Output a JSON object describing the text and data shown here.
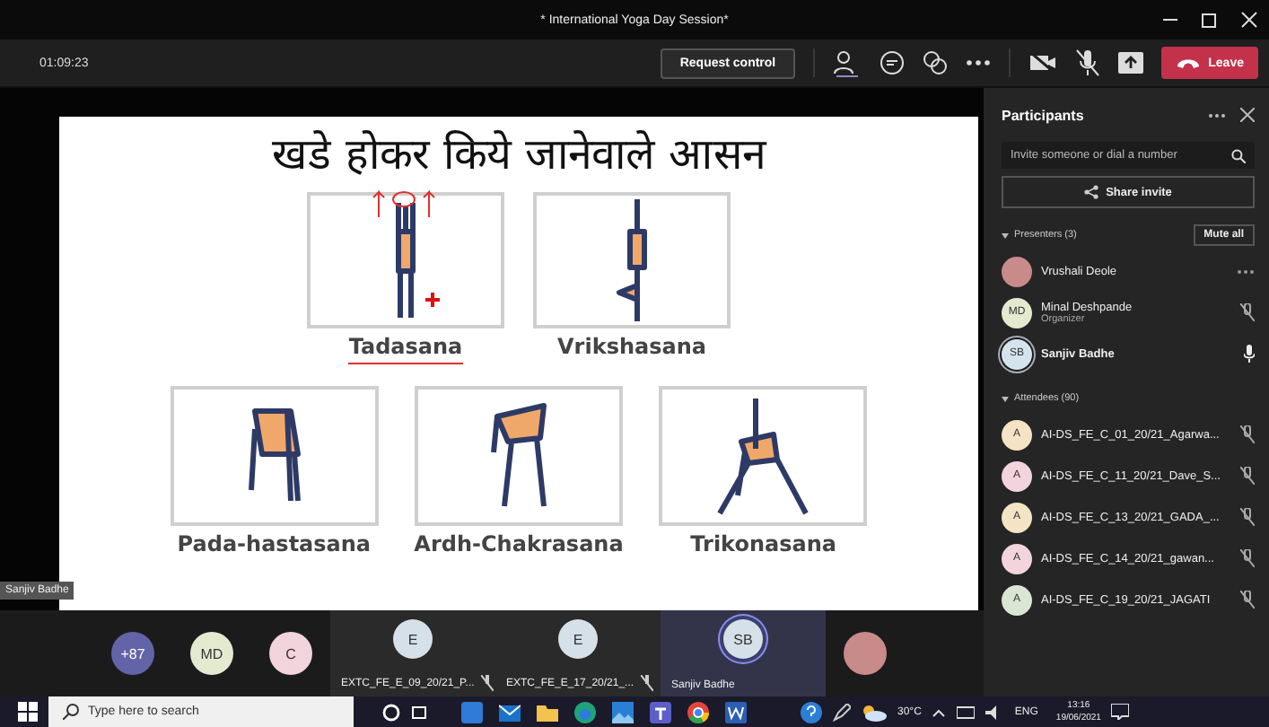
{
  "window": {
    "title": "* International Yoga Day Session*"
  },
  "toolbar": {
    "timer": "01:09:23",
    "request_control": "Request control",
    "leave": "Leave"
  },
  "slide": {
    "title": "खडे होकर किये जानेवाले आसन",
    "presenter_label": "Sanjiv Badhe",
    "rows": [
      [
        {
          "name": "Tadasana",
          "kind": "stand",
          "annotated": true
        },
        {
          "name": "Vrikshasana",
          "kind": "tree",
          "annotated": false
        }
      ],
      [
        {
          "name": "Pada-hastasana",
          "kind": "fold",
          "annotated": false
        },
        {
          "name": "Ardh-Chakrasana",
          "kind": "back",
          "annotated": false
        },
        {
          "name": "Trikonasana",
          "kind": "triangle",
          "annotated": false
        }
      ]
    ]
  },
  "panel": {
    "title": "Participants",
    "invite_placeholder": "Invite someone or dial a number",
    "share_invite": "Share invite",
    "groups": [
      {
        "label": "Presenters (3)",
        "action": "Mute all",
        "people": [
          {
            "name": "Vrushali Deole",
            "kind": "photo",
            "color": "#c98a8a",
            "hovered": true,
            "ring": false
          },
          {
            "name": "Minal Deshpande",
            "kind": "initials",
            "initials": "MD",
            "color": "#e3ead0",
            "role": "Organizer",
            "hovered": false,
            "muted": true,
            "ring": false
          },
          {
            "name": "Sanjiv Badhe",
            "kind": "initials",
            "initials": "SB",
            "color": "#d5e4ec",
            "hovered": false,
            "muted": false,
            "ring": true
          }
        ]
      },
      {
        "label": "Attendees (90)",
        "people": [
          {
            "name": "AI-DS_FE_C_01_20/21_Agarwa...",
            "kind": "initials",
            "initials": "A",
            "color": "#f4e3c4",
            "hovered": false,
            "muted": true,
            "ring": false
          },
          {
            "name": "AI-DS_FE_C_11_20/21_Dave_S...",
            "kind": "initials",
            "initials": "A",
            "color": "#f2d4dc",
            "hovered": false,
            "muted": true,
            "ring": false
          },
          {
            "name": "AI-DS_FE_C_13_20/21_GADA_...",
            "kind": "initials",
            "initials": "A",
            "color": "#f4e3c4",
            "hovered": false,
            "muted": true,
            "ring": false
          },
          {
            "name": "AI-DS_FE_C_14_20/21_gawan...",
            "kind": "initials",
            "initials": "A",
            "color": "#f2d4dc",
            "hovered": false,
            "muted": true,
            "ring": false
          },
          {
            "name": "AI-DS_FE_C_19_20/21_JAGATI",
            "kind": "initials",
            "initials": "A",
            "color": "#d9e6d3",
            "hovered": false,
            "muted": true,
            "ring": false
          }
        ]
      }
    ]
  },
  "strip": [
    {
      "kind": "avatar",
      "initials": "+87",
      "color": "#6264a7"
    },
    {
      "kind": "avatar",
      "initials": "MD",
      "color": "#e3ead0"
    },
    {
      "kind": "avatar",
      "initials": "C",
      "color": "#f2d4dc"
    },
    {
      "kind": "tile",
      "initials": "E",
      "name": "EXTC_FE_E_09_20/21_P...",
      "muted": true,
      "selected": false
    },
    {
      "kind": "tile",
      "initials": "E",
      "name": "EXTC_FE_E_17_20/21_...",
      "muted": true,
      "selected": false
    },
    {
      "kind": "tile",
      "initials": "SB",
      "name": "Sanjiv Badhe",
      "muted": false,
      "selected": true
    },
    {
      "kind": "photo",
      "color": "#c98a8a"
    }
  ],
  "taskbar": {
    "search_placeholder": "Type here to search",
    "weather": "30°C",
    "language": "ENG",
    "time": "13:16",
    "date": "19/06/2021"
  }
}
